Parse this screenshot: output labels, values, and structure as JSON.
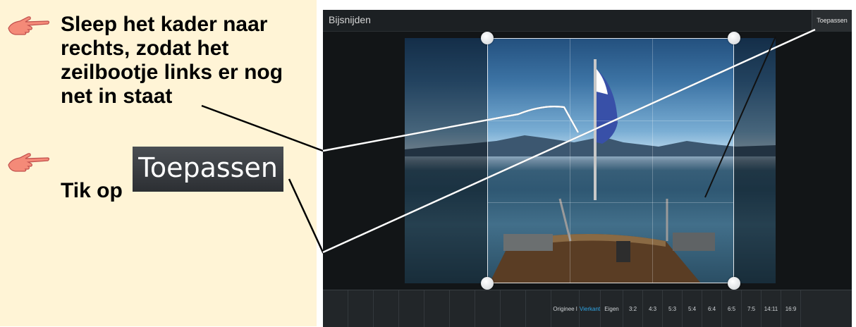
{
  "instructions": {
    "step1_text": "Sleep het kader naar rechts, zodat het zeilbootje links er nog net in staat",
    "step2_prefix": "Tik op",
    "apply_sample": "Toepassen"
  },
  "app": {
    "title": "Bijsnijden",
    "apply_label": "Toepassen"
  },
  "aspect_options": [
    {
      "label": "Originee l",
      "selected": false
    },
    {
      "label": "Vierkant",
      "selected": true
    },
    {
      "label": "Eigen",
      "selected": false
    },
    {
      "label": "3:2",
      "selected": false
    },
    {
      "label": "4:3",
      "selected": false
    },
    {
      "label": "5:3",
      "selected": false
    },
    {
      "label": "5:4",
      "selected": false
    },
    {
      "label": "6:4",
      "selected": false
    },
    {
      "label": "6:5",
      "selected": false
    },
    {
      "label": "7:5",
      "selected": false
    },
    {
      "label": "14:11",
      "selected": false
    },
    {
      "label": "16:9",
      "selected": false
    }
  ],
  "colors": {
    "panel_bg": "#fff4d6",
    "device_bg": "#121517",
    "selected_accent": "#2fa6e6",
    "hand_icon": "#f07060"
  },
  "icons": {
    "step_marker": "pointing-hand-icon"
  }
}
